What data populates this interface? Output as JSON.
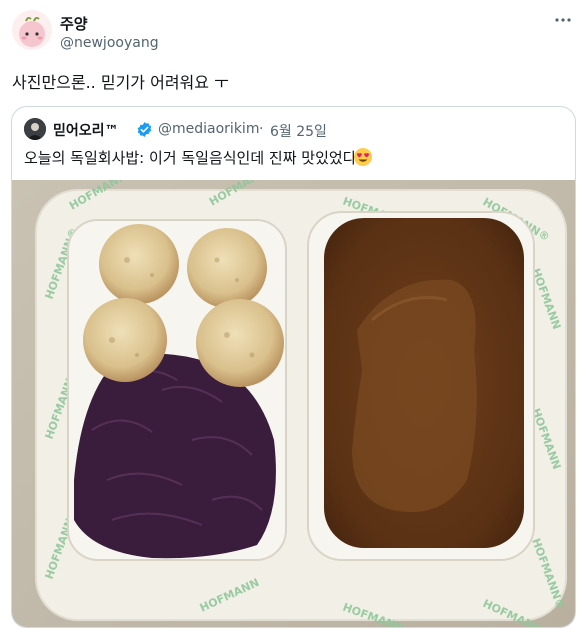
{
  "tweet": {
    "author_name": "주양",
    "author_handle": "@newjooyang",
    "more_icon": "more-horizontal-icon",
    "text": "사진만으론.. 믿기가 어려워요 ㅜ"
  },
  "quote": {
    "author_name": "믿어오리™",
    "verified_icon": "verified-badge-icon",
    "author_handle": "@mediaorikim",
    "separator": "·",
    "date": "6월 25일",
    "text": "오늘의 독일회사밥: 이거 독일음식인데 진짜 맛있었다",
    "emoji": "heart-eyes-emoji",
    "photo": {
      "tray_brand_text": "HOFMANN",
      "tray_brand_text_alt": "HOFMANN®",
      "description_items": [
        "dumplings",
        "red-cabbage",
        "meat-with-gravy"
      ]
    }
  },
  "colors": {
    "verified_blue": "#1d9bf0",
    "handle_gray": "#536471",
    "border": "#cfd9de"
  }
}
